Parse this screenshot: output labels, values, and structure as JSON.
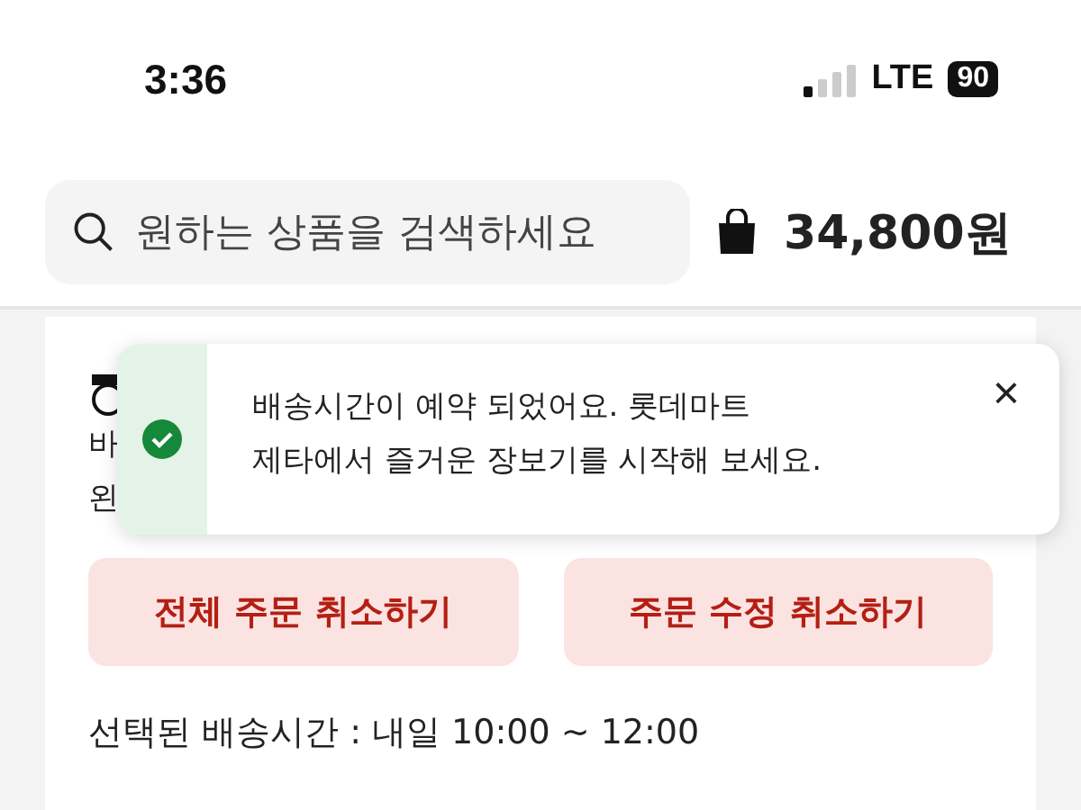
{
  "status_bar": {
    "time": "3:36",
    "network": "LTE",
    "battery": "90"
  },
  "search": {
    "placeholder": "원하는 상품을 검색하세요"
  },
  "cart": {
    "total": "34,800원"
  },
  "card": {
    "partial_lines": [
      "바",
      "왼"
    ],
    "buttons": [
      {
        "label": "전체 주문 취소하기"
      },
      {
        "label": "주문 수정 취소하기"
      }
    ],
    "selected_time": "선택된 배송시간 : 내일 10:00 ~ 12:00"
  },
  "toast": {
    "kind": "success",
    "message": "배송시간이 예약 되었어요. 롯데마트\n제타에서 즐거운 장보기를 시작해 보세요.",
    "close": "×"
  }
}
